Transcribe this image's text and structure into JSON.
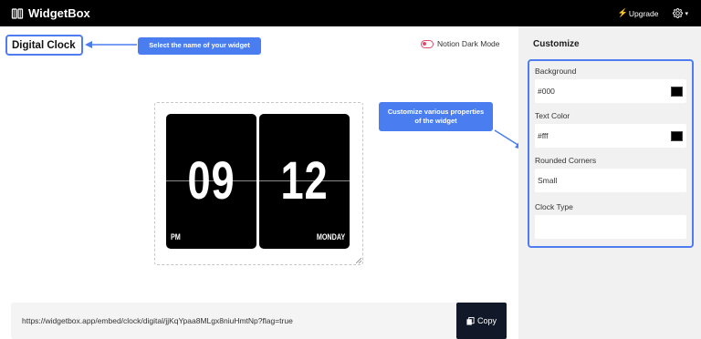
{
  "app": {
    "name": "WidgetBox"
  },
  "header": {
    "upgrade_label": "Upgrade"
  },
  "widget": {
    "name": "Digital Clock"
  },
  "annotations": {
    "select_name": "Select the name of your widget",
    "customize_props": "Customize various properties of the widget"
  },
  "dark_mode_toggle": {
    "label": "Notion Dark Mode",
    "enabled": false
  },
  "clock": {
    "hours": "09",
    "minutes": "12",
    "ampm": "PM",
    "day": "MONDAY"
  },
  "embed": {
    "url": "https://widgetbox.app/embed/clock/digital/jjKqYpaa8MLgx8niuHmtNp?flag=true",
    "copy_label": "Copy"
  },
  "customize": {
    "title": "Customize",
    "background": {
      "label": "Background",
      "value": "#000"
    },
    "text_color": {
      "label": "Text Color",
      "value": "#fff"
    },
    "rounded_corners": {
      "label": "Rounded Corners",
      "value": "Small"
    },
    "clock_type": {
      "label": "Clock Type",
      "value": ""
    }
  },
  "colors": {
    "accent": "#4a7df0",
    "toggle": "#e24c6a",
    "topbar": "#000000",
    "copy_button": "#111827"
  },
  "icons": {
    "brand": "book-icon",
    "upgrade": "lightning-icon",
    "settings": "gear-icon",
    "copy": "copy-icon"
  }
}
